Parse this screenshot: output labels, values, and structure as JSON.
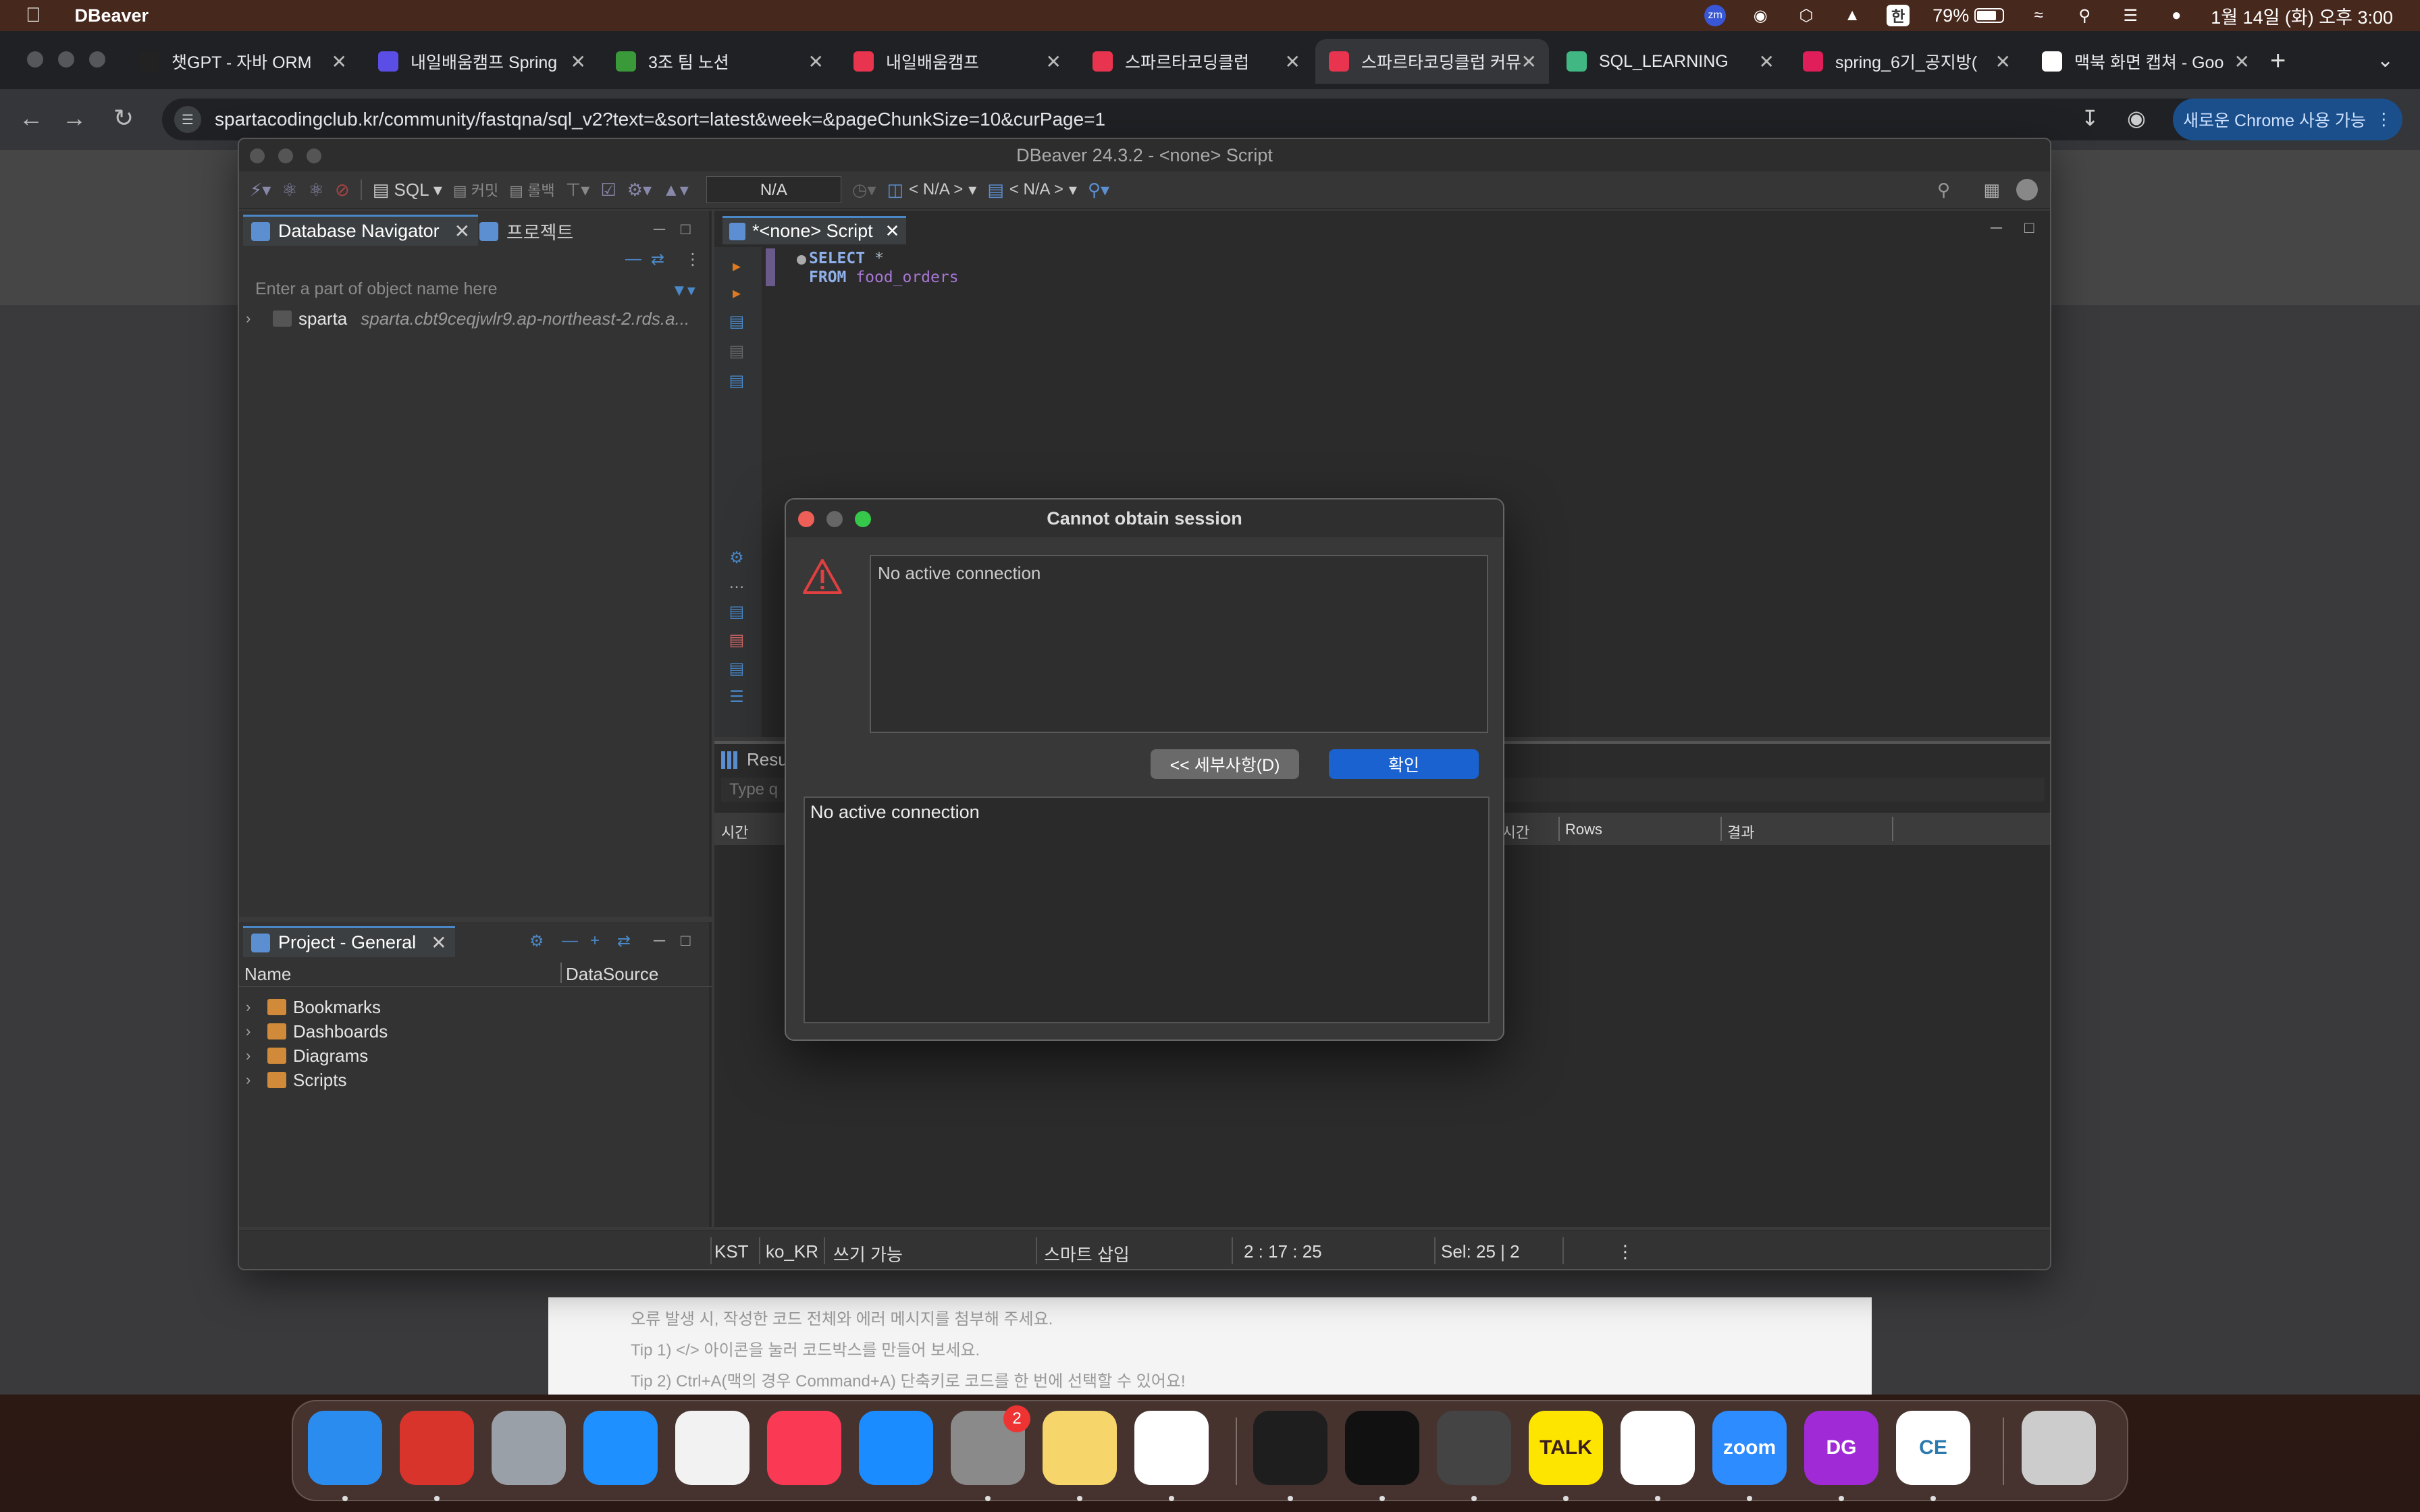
{
  "menubar": {
    "app_name": "DBeaver",
    "battery_percent": "79%",
    "input_method": "한",
    "clock": "1월 14일 (화) 오후 3:00",
    "zoom_badge": "zm"
  },
  "browser": {
    "tabs": [
      {
        "title": "챗GPT - 자바 ORM",
        "icon": "chatgpt-icon",
        "color": "#222222"
      },
      {
        "title": "내일배움캠프 Spring",
        "icon": "zep-icon",
        "color": "#5b4ee6"
      },
      {
        "title": "3조 팀 노션",
        "icon": "clover-icon",
        "color": "#3a9a3a"
      },
      {
        "title": "내일배움캠프",
        "icon": "sparta-heart-icon",
        "color": "#e8344e"
      },
      {
        "title": "스파르타코딩클럽",
        "icon": "sparta-heart-icon",
        "color": "#e8344e"
      },
      {
        "title": "스파르타코딩클럽 커뮤",
        "icon": "sparta-heart-icon",
        "color": "#e8344e"
      },
      {
        "title": "SQL_LEARNING",
        "icon": "vue-icon",
        "color": "#41b883"
      },
      {
        "title": "spring_6기_공지방(",
        "icon": "slack-icon",
        "color": "#e01e5a"
      },
      {
        "title": "맥북 화면 캡쳐 - Goo",
        "icon": "google-icon",
        "color": "#ffffff"
      }
    ],
    "active_tab_index": 5,
    "url": "spartacodingclub.kr/community/fastqna/sql_v2?text=&sort=latest&week=&pageChunkSize=10&curPage=1",
    "chrome_available": "새로운 Chrome 사용 가능"
  },
  "webpage": {
    "tips": [
      "오류 발생 시, 작성한 코드 전체와 에러 메시지를 첨부해 주세요.",
      "Tip 1) </> 아이콘을 눌러 코드박스를 만들어 보세요.",
      "Tip 2) Ctrl+A(맥의 경우 Command+A) 단축키로 코드를 한 번에 선택할 수 있어요!"
    ]
  },
  "dbeaver": {
    "window_title": "DBeaver 24.3.2 - <none> Script",
    "toolbar": {
      "sql_label": "SQL",
      "commit_label": "커밋",
      "rollback_label": "롤백",
      "na_box": "N/A",
      "datasource": "< N/A >",
      "schema": "< N/A >"
    },
    "navigator": {
      "tab_label": "Database Navigator",
      "projects_tab": "프로젝트",
      "filter_placeholder": "Enter a part of object name here",
      "connections": [
        {
          "name": "sparta",
          "host": "sparta.cbt9ceqjwlr9.ap-northeast-2.rds.a..."
        }
      ]
    },
    "project": {
      "tab_label": "Project - General",
      "col_name": "Name",
      "col_datasource": "DataSource",
      "items": [
        "Bookmarks",
        "Dashboards",
        "Diagrams",
        "Scripts"
      ]
    },
    "editor": {
      "tab_label": "*<none> Script",
      "code": {
        "line1_kw": "SELECT",
        "line1_rest": " *",
        "line2_kw": "FROM",
        "line2_table": "food_orders"
      }
    },
    "results": {
      "tab_label": "Resu",
      "filter_placeholder": "Type q",
      "columns": [
        "시간",
        "소요 시간",
        "Rows",
        "결과"
      ]
    },
    "status": {
      "timezone": "KST",
      "locale": "ko_KR",
      "mode": "쓰기 가능",
      "insert": "스마트 삽입",
      "position": "2 : 17 : 25",
      "selection": "Sel: 25 | 2"
    }
  },
  "dialog": {
    "title": "Cannot obtain session",
    "message": "No active connection",
    "details_button": "<< 세부사항(D)",
    "ok_button": "확인",
    "details_text": "No active connection"
  },
  "dock": {
    "apps": [
      {
        "name": "finder",
        "color": "#2b8cf0"
      },
      {
        "name": "photo-booth",
        "color": "#d9342b"
      },
      {
        "name": "launchpad",
        "color": "#9aa0a8"
      },
      {
        "name": "safari",
        "color": "#1e90ff"
      },
      {
        "name": "freeform",
        "color": "#f2f2f2"
      },
      {
        "name": "music",
        "color": "#fa3a55"
      },
      {
        "name": "app-store",
        "color": "#1a8cff"
      },
      {
        "name": "system-settings",
        "color": "#8a8a8a",
        "badge": "2"
      },
      {
        "name": "notes",
        "color": "#f6d56a"
      },
      {
        "name": "chrome",
        "color": "#ffffff"
      },
      {
        "name": "terminal",
        "color": "#1e1e1e"
      },
      {
        "name": "iterm",
        "color": "#111111"
      },
      {
        "name": "unity",
        "color": "#444444"
      },
      {
        "name": "kakaotalk",
        "color": "#fee500",
        "label": "TALK"
      },
      {
        "name": "vscode",
        "color": "#ffffff"
      },
      {
        "name": "zoom",
        "color": "#2d8cff",
        "label": "zoom"
      },
      {
        "name": "datagrip",
        "color": "#a02bd6",
        "label": "DG"
      },
      {
        "name": "dbeaver-ce",
        "color": "#ffffff",
        "label": "CE"
      },
      {
        "name": "trash",
        "color": "#cccccc"
      }
    ]
  }
}
